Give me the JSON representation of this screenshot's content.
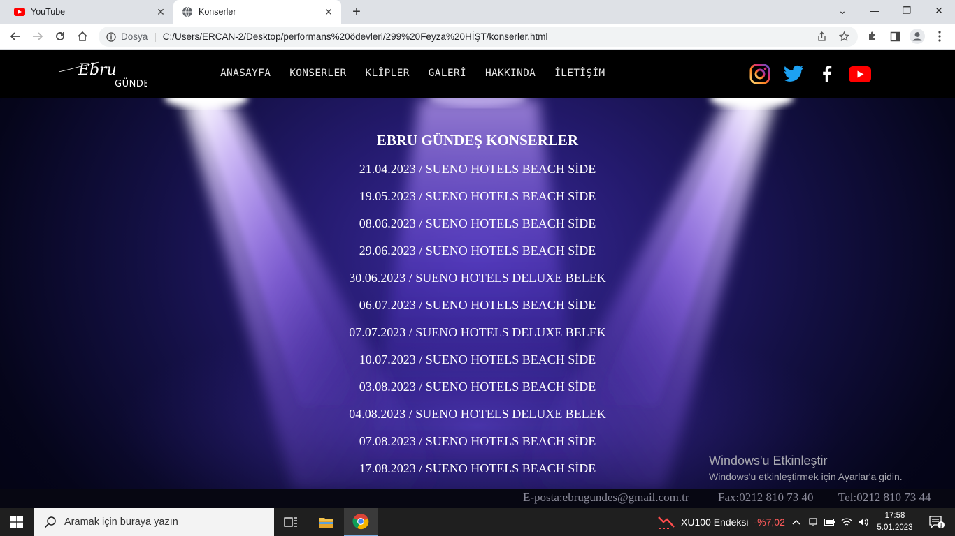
{
  "browser": {
    "tabs": [
      {
        "label": "YouTube"
      },
      {
        "label": "Konserler"
      }
    ],
    "address": {
      "security_label": "Dosya",
      "url": "C:/Users/ERCAN-2/Desktop/performans%20ödevleri/299%20Feyza%20HİŞT/konserler.html"
    }
  },
  "site": {
    "logo": {
      "script": "Ebru",
      "name": "GÜNDEŞ"
    },
    "nav": [
      "ANASAYFA",
      "KONSERLER",
      "KLİPLER",
      "GALERİ",
      "HAKKINDA",
      "İLETİŞİM"
    ],
    "social": [
      "instagram-icon",
      "twitter-icon",
      "facebook-icon",
      "youtube-icon"
    ],
    "title": "EBRU GÜNDEŞ KONSERLER",
    "concerts": [
      "21.04.2023 / SUENO HOTELS BEACH SİDE",
      "19.05.2023 / SUENO HOTELS BEACH SİDE",
      "08.06.2023 / SUENO HOTELS BEACH SİDE",
      "29.06.2023 / SUENO HOTELS BEACH SİDE",
      "30.06.2023 / SUENO HOTELS DELUXE BELEK",
      "06.07.2023 / SUENO HOTELS BEACH SİDE",
      "07.07.2023 / SUENO HOTELS DELUXE BELEK",
      "10.07.2023 / SUENO HOTELS BEACH SİDE",
      "03.08.2023 / SUENO HOTELS BEACH SİDE",
      "04.08.2023 / SUENO HOTELS DELUXE BELEK",
      "07.08.2023 / SUENO HOTELS BEACH SİDE",
      "17.08.2023 / SUENO HOTELS BEACH SİDE"
    ],
    "footer": {
      "email": "E-posta:ebrugundes@gmail.com.tr",
      "fax": "Fax:0212 810 73 40",
      "tel": "Tel:0212 810 73 44"
    }
  },
  "watermark": {
    "title": "Windows'u Etkinleştir",
    "subtitle": "Windows'u etkinleştirmek için Ayarlar'a gidin."
  },
  "taskbar": {
    "search_placeholder": "Aramak için buraya yazın",
    "ticker_label": "XU100 Endeksi",
    "ticker_value": "-%7,02",
    "time": "17:58",
    "date": "5.01.2023",
    "notification_count": "1"
  },
  "colors": {
    "accent_purple": "#3a2a9a",
    "ticker_negative": "#ff5b5b",
    "youtube_red": "#ff0000"
  }
}
